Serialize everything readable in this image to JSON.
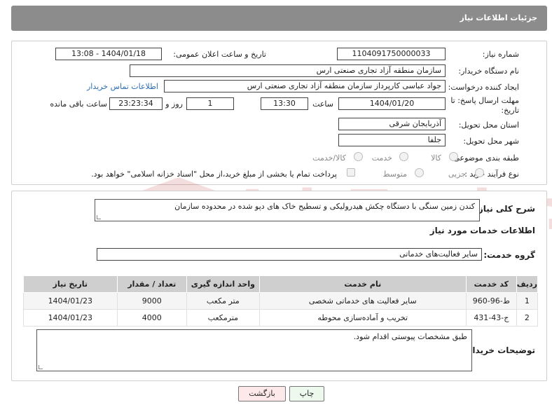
{
  "header": {
    "title": "جزئیات اطلاعات نیاز"
  },
  "info": {
    "need_number_label": "شماره نیاز:",
    "need_number": "1104091750000033",
    "announce_label": "تاریخ و ساعت اعلان عمومی:",
    "announce_value": "1404/01/18 - 13:08",
    "buyer_org_label": "نام دستگاه خریدار:",
    "buyer_org": "سازمان منطقه آزاد تجاری صنعتی ارس",
    "requester_label": "ایجاد کننده درخواست:",
    "requester": "جواد عباسی کارپرداز سازمان منطقه آزاد تجاری صنعتی ارس",
    "contact_link": "اطلاعات تماس خریدار",
    "deadline_label_line1": "مهلت ارسال پاسخ: تا",
    "deadline_label_line2": "تاریخ:",
    "deadline_date": "1404/01/20",
    "time_label": "ساعت",
    "deadline_time": "13:30",
    "days_value": "1",
    "days_label": "روز و",
    "remaining_time": "23:23:34",
    "remaining_label": "ساعت باقی مانده",
    "province_label": "استان محل تحویل:",
    "province": "آذربایجان شرقی",
    "city_label": "شهر محل تحویل:",
    "city": "جلفا",
    "category_label": "طبقه بندی موضوعی:",
    "category_options": [
      "کالا",
      "خدمت",
      "کالا/خدمت"
    ],
    "process_label": "نوع فرآیند خرید :",
    "process_options": [
      "جزیی",
      "متوسط"
    ],
    "payment_note": "پرداخت تمام یا بخشی از مبلغ خرید،از محل \"اسناد خزانه اسلامی\" خواهد بود."
  },
  "description": {
    "summary_label": "شرح کلی نیاز:",
    "summary": "کندن زمین سنگی با دستگاه چکش هیدرولیکی و تسطیح خاک های دپو شده در محدوده سازمان",
    "services_heading": "اطلاعات خدمات مورد نیاز",
    "service_group_label": "گروه خدمت:",
    "service_group": "سایر فعالیت‌های خدماتی",
    "table": {
      "headers": [
        "ردیف",
        "کد خدمت",
        "نام خدمت",
        "واحد اندازه گیری",
        "تعداد / مقدار",
        "تاریخ نیاز"
      ],
      "rows": [
        [
          "1",
          "ط-96-960",
          "سایر فعالیت های خدماتی شخصی",
          "متر مکعب",
          "9000",
          "1404/01/23"
        ],
        [
          "2",
          "ج-43-431",
          "تخریب و آماده‌سازی محوطه",
          "مترمکعب",
          "4000",
          "1404/01/23"
        ]
      ]
    },
    "buyer_notes_label": "توضیحات خریدار:",
    "buyer_notes": "طبق مشخصات پیوستی اقدام شود."
  },
  "buttons": {
    "print": "چاپ",
    "back": "بازگشت"
  },
  "watermark": {
    "text": "AriaTender.neT"
  }
}
